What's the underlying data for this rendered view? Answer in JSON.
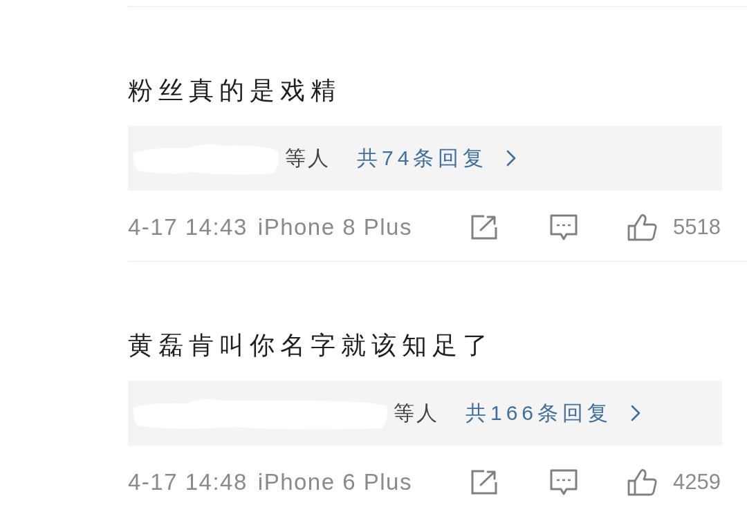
{
  "comments": [
    {
      "text": "粉丝真的是戏精",
      "replies": {
        "names_redacted": true,
        "suffix": "等人",
        "link": "共74条回复"
      },
      "time": "4-17 14:43",
      "device": "iPhone 8 Plus",
      "likes": "5518"
    },
    {
      "text": "黄磊肯叫你名字就该知足了",
      "replies": {
        "names_redacted": true,
        "suffix": "等人",
        "link": "共166条回复"
      },
      "time": "4-17 14:48",
      "device": "iPhone 6 Plus",
      "likes": "4259"
    }
  ]
}
